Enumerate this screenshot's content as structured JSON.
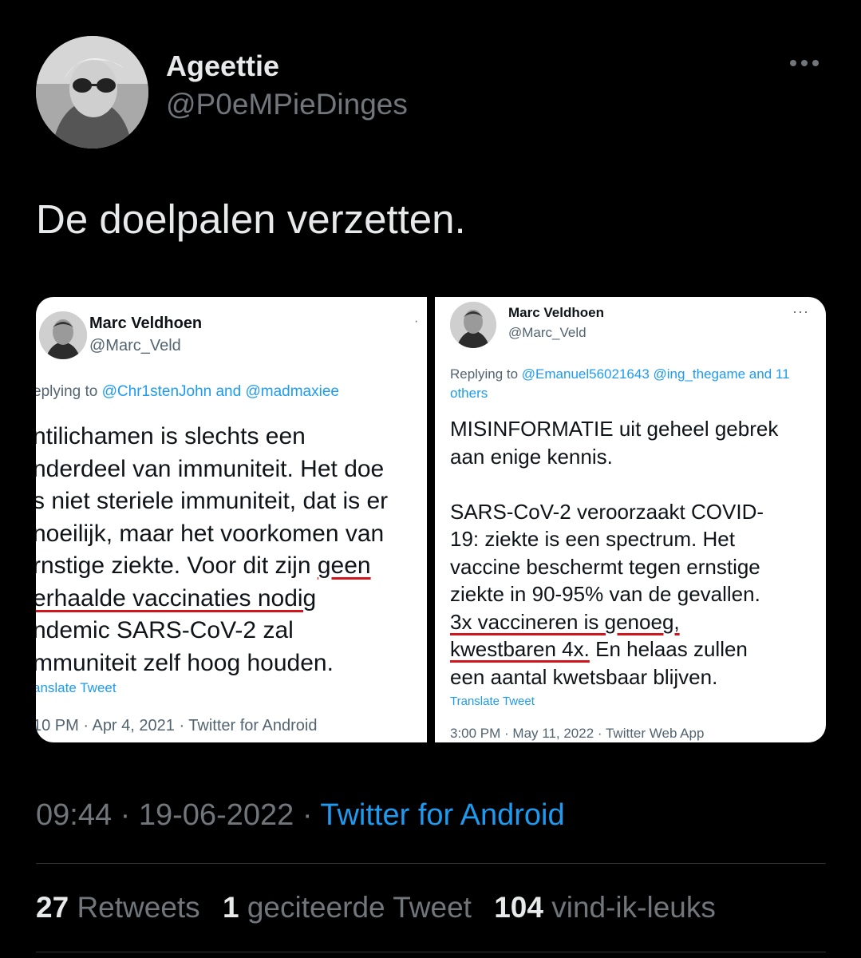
{
  "tweet": {
    "display_name": "Ageettie",
    "handle": "@P0eMPieDinges",
    "text": "De doelpalen verzetten.",
    "time": "09:44",
    "date": "19-06-2022",
    "separator": "·",
    "source": "Twitter for Android"
  },
  "stats": {
    "retweets_count": "27",
    "retweets_label": "Retweets",
    "quotes_count": "1",
    "quotes_label": "geciteerde Tweet",
    "likes_count": "104",
    "likes_label": "vind-ik-leuks"
  },
  "embedded_left": {
    "name": "Marc Veldhoen",
    "handle": "@Marc_Veld",
    "replying_prefix": "eplying to",
    "replying_to": "@Chr1stenJohn and @madmaxiee",
    "lines": [
      "ntilichamen is slechts een",
      "nderdeel van immuniteit. Het doe",
      "s niet steriele immuniteit, dat is er",
      "noeilijk, maar het voorkomen van",
      "rnstige ziekte. Voor dit zijn geen",
      "erhaalde vaccinaties nodig",
      "ndemic SARS-CoV-2 zal",
      "mmuniteit zelf hoog houden."
    ],
    "translate": "anslate Tweet",
    "meta": "10 PM · Apr 4, 2021 · Twitter for Android"
  },
  "embedded_right": {
    "name": "Marc Veldhoen",
    "handle": "@Marc_Veld",
    "replying_prefix": "Replying to",
    "replying_to": "@Emanuel56021643 @ing_thegame and 11",
    "replying_to_2": "others",
    "lines": [
      "MISINFORMATIE uit geheel gebrek",
      "aan enige kennis.",
      "",
      "SARS-CoV-2 veroorzaakt COVID-",
      "19: ziekte is een spectrum. Het",
      "vaccine beschermt tegen ernstige",
      "ziekte in 90-95% van de gevallen.",
      "3x vaccineren is genoeg,",
      "kwestbaren 4x. En helaas zullen",
      "een aantal kwetsbaar blijven."
    ],
    "translate": "Translate Tweet",
    "meta": "3:00 PM · May 11, 2022 · Twitter Web App"
  },
  "icons": {
    "more": "more-horizontal-icon",
    "underline_color": "#d0151c"
  },
  "colors": {
    "background": "#000000",
    "text": "#e7e9ea",
    "secondary": "#71767b",
    "link": "#1d9bf0"
  }
}
